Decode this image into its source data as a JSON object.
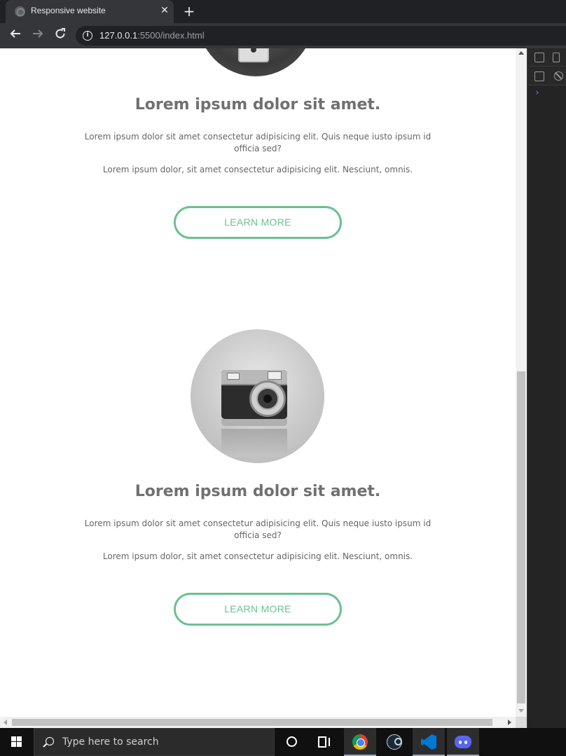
{
  "browser": {
    "tab_title": "Responsive website",
    "url_host": "127.0.0.1",
    "url_rest": ":5500/index.html"
  },
  "sections": [
    {
      "title": "Lorem ipsum dolor sit amet.",
      "para1": "Lorem ipsum dolor sit amet consectetur adipisicing elit. Quis neque iusto ipsum id officia sed?",
      "para2": "Lorem ipsum dolor, sit amet consectetur adipisicing elit. Nesciunt, omnis.",
      "button": "LEARN MORE",
      "image": "phone-photo"
    },
    {
      "title": "Lorem ipsum dolor sit amet.",
      "para1": "Lorem ipsum dolor sit amet consectetur adipisicing elit. Quis neque iusto ipsum id officia sed?",
      "para2": "Lorem ipsum dolor, sit amet consectetur adipisicing elit. Nesciunt, omnis.",
      "button": "LEARN MORE",
      "image": "camera-photo"
    }
  ],
  "taskbar": {
    "search_placeholder": "Type here to search",
    "apps": [
      "chrome-icon",
      "steam-icon",
      "vscode-icon",
      "discord-icon"
    ]
  },
  "colors": {
    "accent": "#6cc091",
    "heading": "#707070",
    "text": "#666666"
  }
}
